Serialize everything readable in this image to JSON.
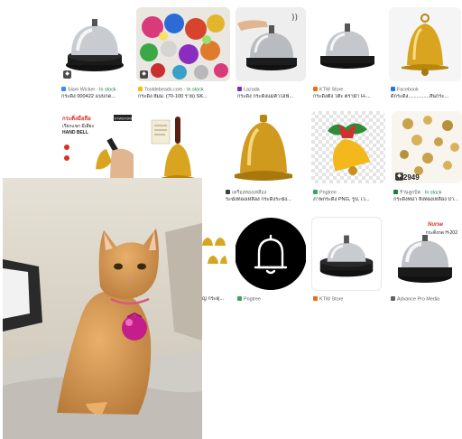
{
  "results": [
    {
      "source": "Siam Wicker",
      "stock": "In stock",
      "title": "กระดิ่ง 000422 แบบกด...",
      "favicon_color": "#4285f4"
    },
    {
      "source": "Tooldebeads.com",
      "stock": "In stock",
      "title": "กระดิ่ง 8มม. (70-100 ราย) SK...",
      "favicon_color": "#fbbc04"
    },
    {
      "source": "Lazada",
      "stock": "",
      "title": "กระดิ่ง กระดิ่งแม่ค้าไฮฟ์...",
      "favicon_color": "#7b2cbf"
    },
    {
      "source": "KTW Store",
      "stock": "",
      "title": "กระดิ่งตั้ง โต๊ะ ตราม้า H-...",
      "favicon_color": "#e8710a"
    },
    {
      "source": "Facebook",
      "stock": "",
      "title": "ดีกระดิ่ง...............สั่นกระ...",
      "favicon_color": "#1877f2"
    },
    {
      "source": "",
      "stock": "",
      "title": "",
      "favicon_color": "#9aa0a6"
    },
    {
      "source": "",
      "stock": "",
      "title": "",
      "favicon_color": "#9aa0a6"
    },
    {
      "source": "เครื่องทองเหลือง",
      "stock": "",
      "title": "ระฆังทองเหลือง กระดิ่งระฆัง...",
      "favicon_color": "#3c4043"
    },
    {
      "source": "Pngtree",
      "stock": "",
      "title": "ภาพกระดิ่ง PNG, รูป, เว...",
      "favicon_color": "#34a853"
    },
    {
      "source": "ร้านลูกบิด",
      "stock": "In stock",
      "title": "กระดิ่งหม่า ลิงทองเหลือง ปา...",
      "favicon_color": "#188038"
    },
    {
      "source": "",
      "stock": "",
      "title": "ญ่ กระดุ...",
      "favicon_color": "#9aa0a6"
    },
    {
      "source": "Pngtree",
      "stock": "",
      "title": "",
      "favicon_color": "#34a853"
    },
    {
      "source": "KTW Store",
      "stock": "",
      "title": "",
      "favicon_color": "#e8710a"
    },
    {
      "source": "Advance Pro Media",
      "stock": "",
      "title": "",
      "favicon_color": "#5f6368"
    }
  ],
  "thumb_texts": {
    "handbell_heading": "กระดิ่งมือถือ",
    "handbell_sub": "เรียกแขก มีเสียง",
    "handbell_en": "HAND BELL",
    "handbell_brand": "KTWSTORE",
    "jingle_code": "502949",
    "nurse_brand": "Nurse",
    "nurse_model": "กระดิ่งกด H-202",
    "fb_mark": "f"
  },
  "colors": {
    "accent": "#188038",
    "link_gray": "#5f6368"
  }
}
